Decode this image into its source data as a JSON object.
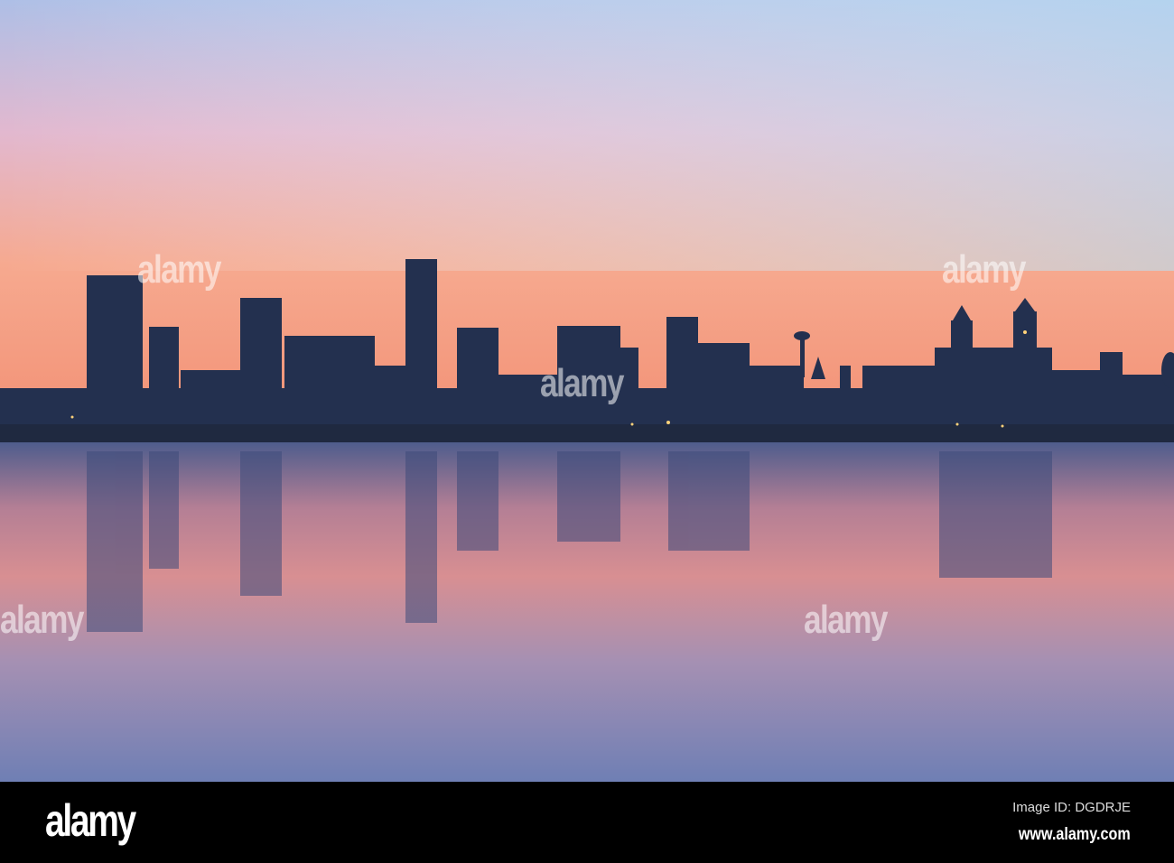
{
  "photo": {
    "subject": "city-skyline-sunrise-reflection",
    "sky_colors": [
      "#b9c9ec",
      "#f6b7b7",
      "#f7946e"
    ],
    "water_colors": [
      "#6c7fb0",
      "#d48a95",
      "#7f8cb9"
    ]
  },
  "watermark": {
    "text": "alamy"
  },
  "footer": {
    "logo": "alamy",
    "image_id": "Image ID: DGDRJE",
    "website": "www.alamy.com"
  }
}
